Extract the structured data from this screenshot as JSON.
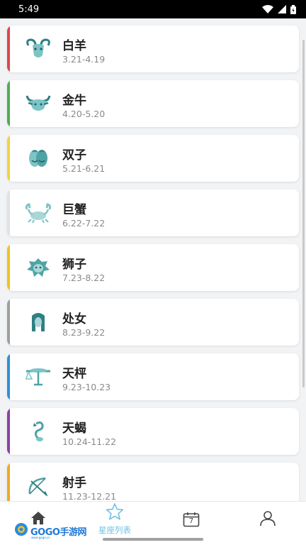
{
  "status_bar": {
    "time": "5:49"
  },
  "zodiac_list": [
    {
      "name": "白羊",
      "dates": "3.21-4.19",
      "accent": "#e0454b",
      "icon": "aries-icon"
    },
    {
      "name": "金牛",
      "dates": "4.20-5.20",
      "accent": "#4caf50",
      "icon": "taurus-icon"
    },
    {
      "name": "双子",
      "dates": "5.21-6.21",
      "accent": "#f2d43a",
      "icon": "gemini-icon"
    },
    {
      "name": "巨蟹",
      "dates": "6.22-7.22",
      "accent": "#e2e2e2",
      "icon": "cancer-icon"
    },
    {
      "name": "狮子",
      "dates": "7.23-8.22",
      "accent": "#f0c419",
      "icon": "leo-icon"
    },
    {
      "name": "处女",
      "dates": "8.23-9.22",
      "accent": "#9e9e9e",
      "icon": "virgo-icon"
    },
    {
      "name": "天枰",
      "dates": "9.23-10.23",
      "accent": "#2f8fd8",
      "icon": "libra-icon"
    },
    {
      "name": "天蝎",
      "dates": "10.24-11.22",
      "accent": "#8e3fa8",
      "icon": "scorpio-icon"
    },
    {
      "name": "射手",
      "dates": "11.23-12.21",
      "accent": "#f0a91e",
      "icon": "sagittarius-icon"
    }
  ],
  "tab_bar": {
    "active_tab": "zodiac_list",
    "tabs": [
      {
        "id": "home",
        "icon": "home-icon",
        "label": ""
      },
      {
        "id": "zodiac_list",
        "icon": "star-icon",
        "label": "星座列表"
      },
      {
        "id": "calendar",
        "icon": "calendar-icon",
        "label": "",
        "calendar_day": "7"
      },
      {
        "id": "profile",
        "icon": "user-icon",
        "label": ""
      }
    ]
  },
  "watermark": {
    "text": "GOGO手游网",
    "sub": "www.gogo.cn"
  },
  "colors": {
    "icon_teal": "#4fa3a5",
    "tab_active": "#6ec1e4",
    "tab_inactive": "#444444"
  }
}
